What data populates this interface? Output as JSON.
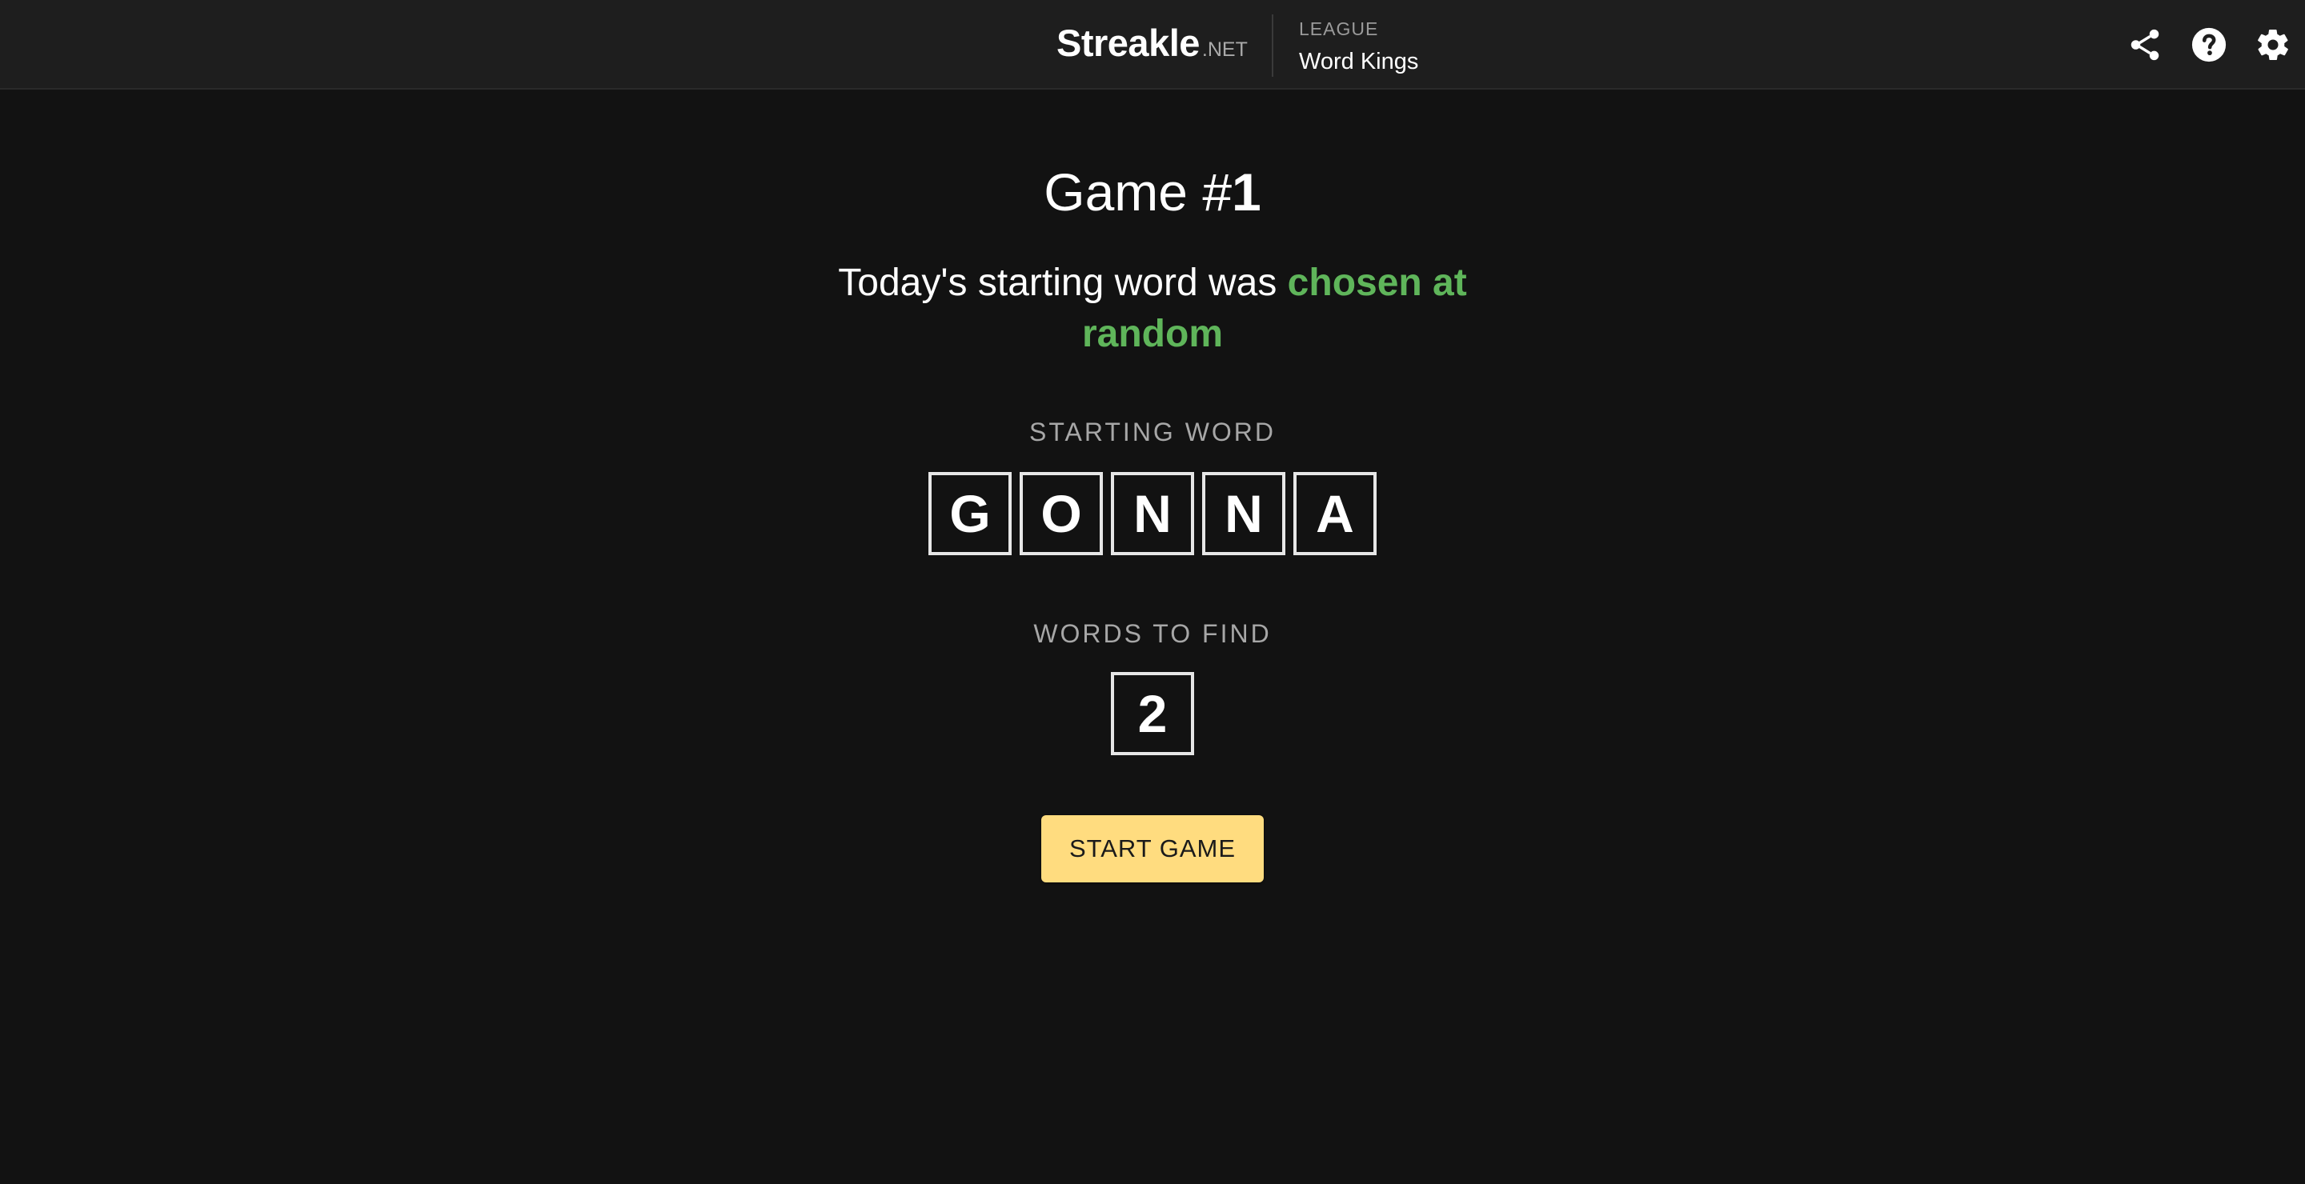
{
  "header": {
    "brand_name": "Streakle",
    "brand_suffix": ".NET",
    "league_label": "LEAGUE",
    "league_name": "Word Kings",
    "icons": [
      "share-icon",
      "help-icon",
      "settings-icon"
    ]
  },
  "game": {
    "title_prefix": "Game #",
    "number": "1",
    "tagline_prefix": "Today's starting word was ",
    "tagline_accent": "chosen at random",
    "starting_word_label": "STARTING WORD",
    "starting_word_letters": [
      "G",
      "O",
      "N",
      "N",
      "A"
    ],
    "words_to_find_label": "WORDS TO FIND",
    "words_to_find": "2",
    "start_button_label": "START GAME"
  },
  "colors": {
    "background": "#121212",
    "header_bg": "#1e1e1e",
    "accent_green": "#5fb55a",
    "button_yellow": "#ffdc7f",
    "tile_border": "#e6e6e6"
  }
}
